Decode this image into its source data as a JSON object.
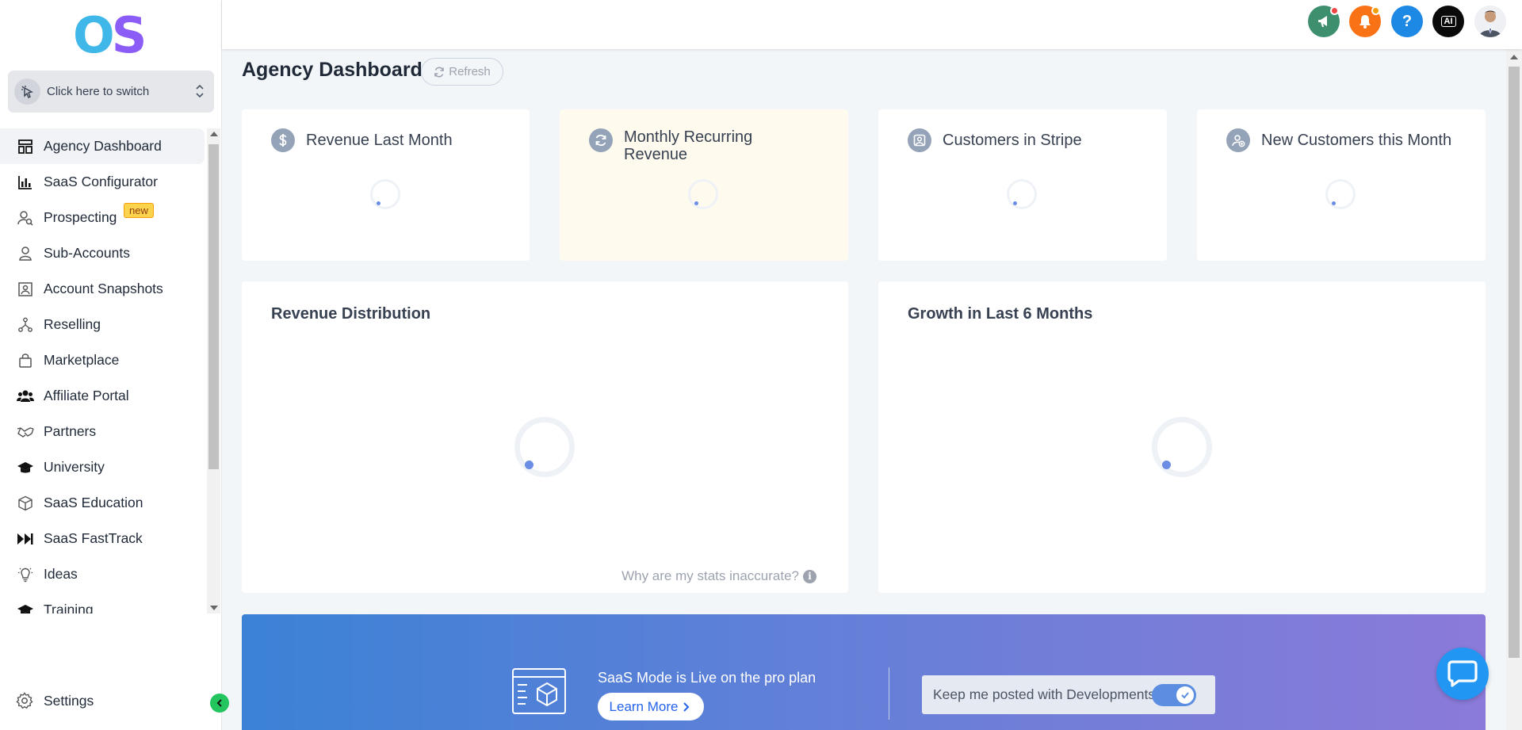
{
  "logo": {
    "o": "O",
    "s": "S"
  },
  "switcher": {
    "label": "Click here to switch"
  },
  "nav": {
    "items": [
      {
        "label": "Agency Dashboard",
        "icon": "dashboard-icon",
        "active": true
      },
      {
        "label": "SaaS Configurator",
        "icon": "bar-chart-icon"
      },
      {
        "label": "Prospecting",
        "icon": "user-search-icon",
        "badge": "new"
      },
      {
        "label": "Sub-Accounts",
        "icon": "user-icon"
      },
      {
        "label": "Account Snapshots",
        "icon": "snapshot-icon"
      },
      {
        "label": "Reselling",
        "icon": "hierarchy-icon"
      },
      {
        "label": "Marketplace",
        "icon": "shopping-bag-icon"
      },
      {
        "label": "Affiliate Portal",
        "icon": "users-icon"
      },
      {
        "label": "Partners",
        "icon": "handshake-icon"
      },
      {
        "label": "University",
        "icon": "graduation-cap-icon"
      },
      {
        "label": "SaaS Education",
        "icon": "box-icon"
      },
      {
        "label": "SaaS FastTrack",
        "icon": "fast-forward-icon"
      },
      {
        "label": "Ideas",
        "icon": "lightbulb-icon"
      },
      {
        "label": "Training",
        "icon": "graduation-cap-icon"
      }
    ],
    "settings": "Settings"
  },
  "header": {
    "buttons": [
      {
        "name": "announcements-button",
        "color": "#3d8f6e",
        "dot": "#ef4444"
      },
      {
        "name": "notifications-button",
        "color": "#f97316",
        "dot": "#f59e0b"
      },
      {
        "name": "help-button",
        "color": "#1e88e5",
        "label": "?"
      },
      {
        "name": "ai-button",
        "color": "#0a0a0a",
        "label": "AI"
      }
    ]
  },
  "page": {
    "title": "Agency Dashboard",
    "refresh": "Refresh"
  },
  "stats": [
    {
      "title": "Revenue Last Month",
      "icon": "dollar-icon"
    },
    {
      "title": "Monthly Recurring Revenue",
      "icon": "recurring-icon"
    },
    {
      "title": "Customers in Stripe",
      "icon": "customers-icon"
    },
    {
      "title": "New Customers this Month",
      "icon": "new-customer-icon"
    }
  ],
  "panels": {
    "revenue_distribution": "Revenue Distribution",
    "growth": "Growth in Last 6 Months",
    "why_inaccurate": "Why are my stats inaccurate?"
  },
  "banner": {
    "text": "SaaS Mode is Live on the pro plan",
    "learn_more": "Learn More",
    "keep_posted": "Keep me posted with Developments",
    "toggle_on": true
  },
  "colors": {
    "accent": "#2563eb",
    "active_nav_bg": "#f1f3f6",
    "yellow_card": "#fefaee"
  }
}
